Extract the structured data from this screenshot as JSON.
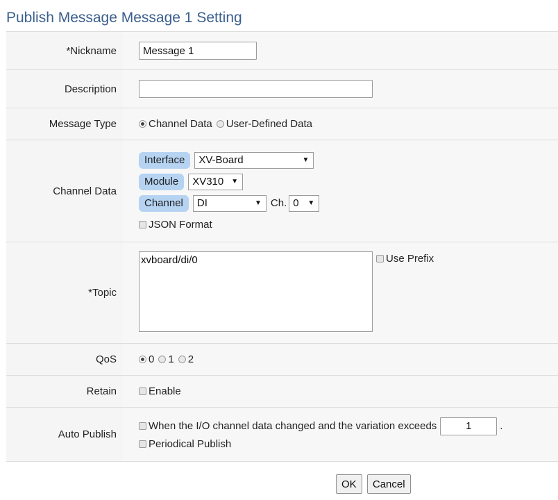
{
  "page": {
    "title": "Publish Message Message 1 Setting"
  },
  "nickname": {
    "label": "*Nickname",
    "value": "Message 1"
  },
  "description": {
    "label": "Description",
    "value": ""
  },
  "message_type": {
    "label": "Message Type",
    "options": [
      "Channel Data",
      "User-Defined Data"
    ],
    "selected": "Channel Data"
  },
  "channel_data": {
    "label": "Channel Data",
    "interface_label": "Interface",
    "interface_value": "XV-Board",
    "module_label": "Module",
    "module_value": "XV310",
    "channel_label": "Channel",
    "channel_value": "DI",
    "ch_label": "Ch.",
    "ch_value": "0",
    "json_format_label": "JSON Format",
    "json_format_checked": false
  },
  "topic": {
    "label": "*Topic",
    "value": "xvboard/di/0",
    "use_prefix_label": "Use Prefix",
    "use_prefix_checked": false
  },
  "qos": {
    "label": "QoS",
    "options": [
      "0",
      "1",
      "2"
    ],
    "selected": "0"
  },
  "retain": {
    "label": "Retain",
    "enable_label": "Enable",
    "checked": false
  },
  "auto_publish": {
    "label": "Auto Publish",
    "variation_label": "When the I/O channel data changed and the variation exceeds",
    "variation_value": "1",
    "variation_suffix": ".",
    "periodical_label": "Periodical Publish"
  },
  "buttons": {
    "ok": "OK",
    "cancel": "Cancel"
  },
  "colors": {
    "title": "#3a5f8d",
    "pill": "#b6d3f2",
    "row_bg": "#f7f7f7"
  }
}
